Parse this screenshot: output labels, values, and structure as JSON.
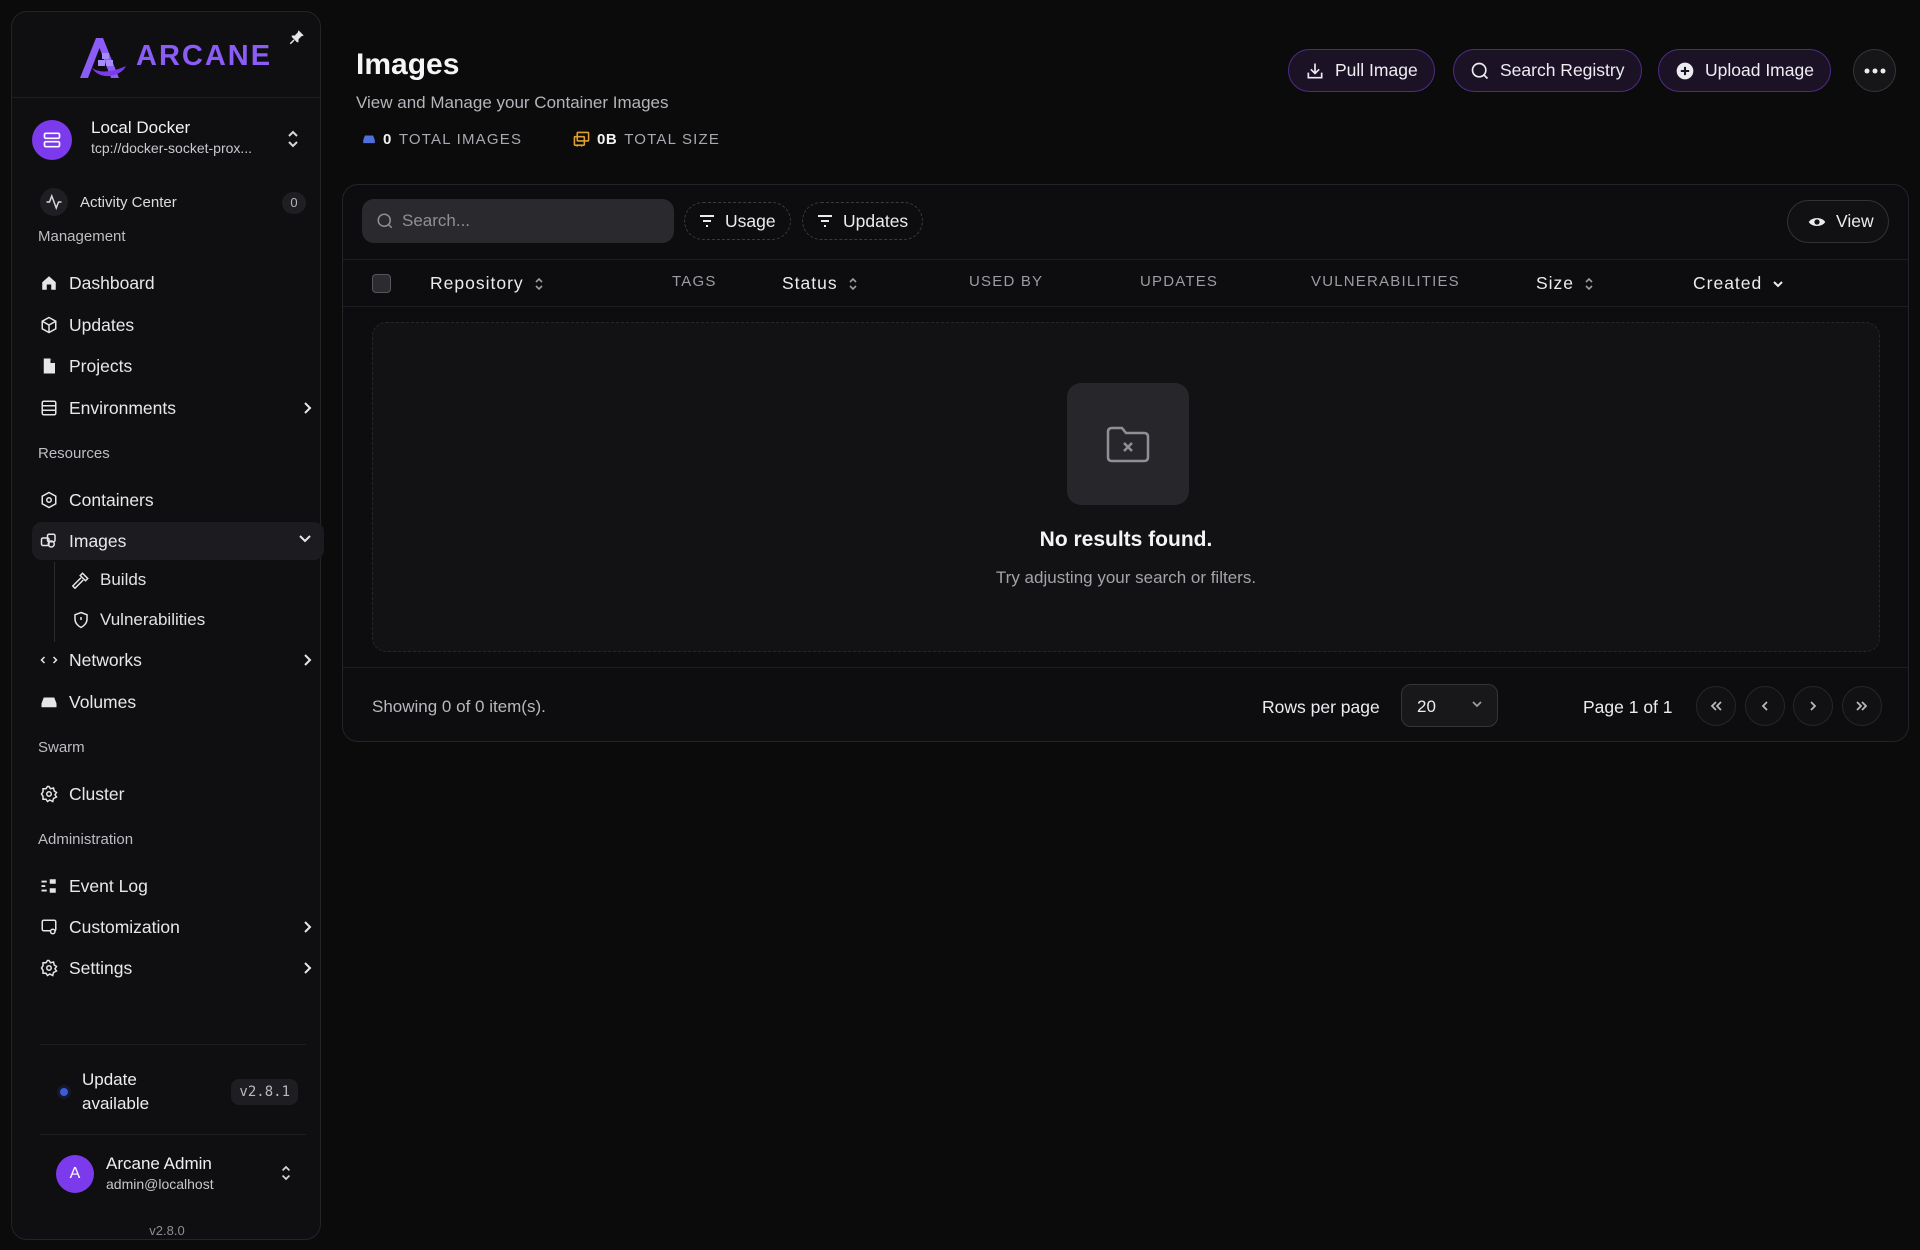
{
  "brand": {
    "name": "ARCANE"
  },
  "environment": {
    "name": "Local Docker",
    "url": "tcp://docker-socket-prox..."
  },
  "activity": {
    "label": "Activity Center",
    "count": "0"
  },
  "sections": {
    "management": "Management",
    "resources": "Resources",
    "swarm": "Swarm",
    "administration": "Administration"
  },
  "nav": {
    "dashboard": "Dashboard",
    "updates": "Updates",
    "projects": "Projects",
    "environments": "Environments",
    "containers": "Containers",
    "images": "Images",
    "builds": "Builds",
    "vulnerabilities": "Vulnerabilities",
    "networks": "Networks",
    "volumes": "Volumes",
    "cluster": "Cluster",
    "event_log": "Event Log",
    "customization": "Customization",
    "settings": "Settings"
  },
  "update_notice": {
    "line1": "Update",
    "line2": "available",
    "version": "v2.8.1"
  },
  "user": {
    "initial": "A",
    "name": "Arcane Admin",
    "email": "admin@localhost"
  },
  "app_version": "v2.8.0",
  "page": {
    "title": "Images",
    "subtitle": "View and Manage your Container Images",
    "stats": {
      "total_images_value": "0",
      "total_images_label": "TOTAL IMAGES",
      "total_size_value": "0B",
      "total_size_label": "TOTAL SIZE"
    }
  },
  "actions": {
    "pull": "Pull Image",
    "search_registry": "Search Registry",
    "upload": "Upload Image"
  },
  "toolbar": {
    "search_placeholder": "Search...",
    "filter_usage": "Usage",
    "filter_updates": "Updates",
    "view": "View"
  },
  "columns": {
    "repository": "Repository",
    "tags": "TAGS",
    "status": "Status",
    "used_by": "USED BY",
    "updates": "UPDATES",
    "vulnerabilities": "VULNERABILITIES",
    "size": "Size",
    "created": "Created"
  },
  "empty_state": {
    "title": "No results found.",
    "subtitle": "Try adjusting your search or filters."
  },
  "pagination": {
    "showing": "Showing 0 of 0 item(s).",
    "rows_per_page_label": "Rows per page",
    "rows_per_page_value": "20",
    "page_info": "Page 1 of 1"
  },
  "colors": {
    "accent": "#8b5cf6",
    "accent_dark": "#7c3aed",
    "background": "#0b0b0c",
    "update_dot": "#3b5bdb",
    "images_icon": "#4f6fdc",
    "size_icon": "#e0a030"
  },
  "icons": {
    "brand": "arcane-logo-icon",
    "pin": "pin-icon",
    "environment": "server-icon",
    "activity": "activity-icon",
    "pull": "download-icon",
    "search": "search-icon",
    "upload": "plus-circle-icon",
    "more": "ellipsis-icon",
    "filter": "filter-icon",
    "view": "eye-icon",
    "empty": "folder-x-icon"
  }
}
